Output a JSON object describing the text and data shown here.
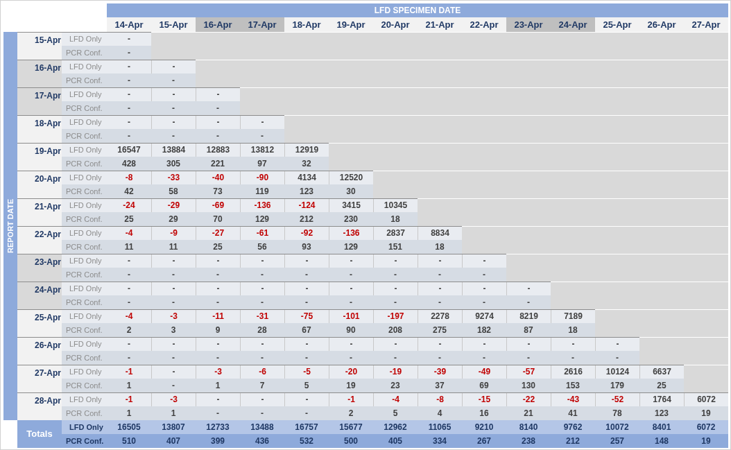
{
  "title": "LFD SPECIMEN DATE",
  "side_title": "REPORT DATE",
  "columns": [
    {
      "label": "14-Apr",
      "weekend": false
    },
    {
      "label": "15-Apr",
      "weekend": false
    },
    {
      "label": "16-Apr",
      "weekend": true
    },
    {
      "label": "17-Apr",
      "weekend": true
    },
    {
      "label": "18-Apr",
      "weekend": false
    },
    {
      "label": "19-Apr",
      "weekend": false
    },
    {
      "label": "20-Apr",
      "weekend": false
    },
    {
      "label": "21-Apr",
      "weekend": false
    },
    {
      "label": "22-Apr",
      "weekend": false
    },
    {
      "label": "23-Apr",
      "weekend": true
    },
    {
      "label": "24-Apr",
      "weekend": true
    },
    {
      "label": "25-Apr",
      "weekend": false
    },
    {
      "label": "26-Apr",
      "weekend": false
    },
    {
      "label": "27-Apr",
      "weekend": false
    }
  ],
  "rows": [
    {
      "date": "15-Apr",
      "weekend": false,
      "lfd_label": "LFD Only",
      "pcr_label": "PCR Conf.",
      "lfd": [
        {
          "value": "-",
          "negative": false
        }
      ],
      "pcr": [
        "-"
      ]
    },
    {
      "date": "16-Apr",
      "weekend": true,
      "lfd_label": "LFD Only",
      "pcr_label": "PCR Conf.",
      "lfd": [
        {
          "value": "-",
          "negative": false
        },
        {
          "value": "-",
          "negative": false
        }
      ],
      "pcr": [
        "-",
        "-"
      ]
    },
    {
      "date": "17-Apr",
      "weekend": true,
      "lfd_label": "LFD Only",
      "pcr_label": "PCR Conf.",
      "lfd": [
        {
          "value": "-",
          "negative": false
        },
        {
          "value": "-",
          "negative": false
        },
        {
          "value": "-",
          "negative": false
        }
      ],
      "pcr": [
        "-",
        "-",
        "-"
      ]
    },
    {
      "date": "18-Apr",
      "weekend": false,
      "lfd_label": "LFD Only",
      "pcr_label": "PCR Conf.",
      "lfd": [
        {
          "value": "-",
          "negative": false
        },
        {
          "value": "-",
          "negative": false
        },
        {
          "value": "-",
          "negative": false
        },
        {
          "value": "-",
          "negative": false
        }
      ],
      "pcr": [
        "-",
        "-",
        "-",
        "-"
      ]
    },
    {
      "date": "19-Apr",
      "weekend": false,
      "lfd_label": "LFD Only",
      "pcr_label": "PCR Conf.",
      "lfd": [
        {
          "value": "16547",
          "negative": false
        },
        {
          "value": "13884",
          "negative": false
        },
        {
          "value": "12883",
          "negative": false
        },
        {
          "value": "13812",
          "negative": false
        },
        {
          "value": "12919",
          "negative": false
        }
      ],
      "pcr": [
        "428",
        "305",
        "221",
        "97",
        "32"
      ]
    },
    {
      "date": "20-Apr",
      "weekend": false,
      "lfd_label": "LFD Only",
      "pcr_label": "PCR Conf.",
      "lfd": [
        {
          "value": "-8",
          "negative": true
        },
        {
          "value": "-33",
          "negative": true
        },
        {
          "value": "-40",
          "negative": true
        },
        {
          "value": "-90",
          "negative": true
        },
        {
          "value": "4134",
          "negative": false
        },
        {
          "value": "12520",
          "negative": false
        }
      ],
      "pcr": [
        "42",
        "58",
        "73",
        "119",
        "123",
        "30"
      ]
    },
    {
      "date": "21-Apr",
      "weekend": false,
      "lfd_label": "LFD Only",
      "pcr_label": "PCR Conf.",
      "lfd": [
        {
          "value": "-24",
          "negative": true
        },
        {
          "value": "-29",
          "negative": true
        },
        {
          "value": "-69",
          "negative": true
        },
        {
          "value": "-136",
          "negative": true
        },
        {
          "value": "-124",
          "negative": true
        },
        {
          "value": "3415",
          "negative": false
        },
        {
          "value": "10345",
          "negative": false
        }
      ],
      "pcr": [
        "25",
        "29",
        "70",
        "129",
        "212",
        "230",
        "18"
      ]
    },
    {
      "date": "22-Apr",
      "weekend": false,
      "lfd_label": "LFD Only",
      "pcr_label": "PCR Conf.",
      "lfd": [
        {
          "value": "-4",
          "negative": true
        },
        {
          "value": "-9",
          "negative": true
        },
        {
          "value": "-27",
          "negative": true
        },
        {
          "value": "-61",
          "negative": true
        },
        {
          "value": "-92",
          "negative": true
        },
        {
          "value": "-136",
          "negative": true
        },
        {
          "value": "2837",
          "negative": false
        },
        {
          "value": "8834",
          "negative": false
        }
      ],
      "pcr": [
        "11",
        "11",
        "25",
        "56",
        "93",
        "129",
        "151",
        "18"
      ]
    },
    {
      "date": "23-Apr",
      "weekend": true,
      "lfd_label": "LFD Only",
      "pcr_label": "PCR Conf.",
      "lfd": [
        {
          "value": "-",
          "negative": false
        },
        {
          "value": "-",
          "negative": false
        },
        {
          "value": "-",
          "negative": false
        },
        {
          "value": "-",
          "negative": false
        },
        {
          "value": "-",
          "negative": false
        },
        {
          "value": "-",
          "negative": false
        },
        {
          "value": "-",
          "negative": false
        },
        {
          "value": "-",
          "negative": false
        },
        {
          "value": "-",
          "negative": false
        }
      ],
      "pcr": [
        "-",
        "-",
        "-",
        "-",
        "-",
        "-",
        "-",
        "-",
        "-"
      ]
    },
    {
      "date": "24-Apr",
      "weekend": true,
      "lfd_label": "LFD Only",
      "pcr_label": "PCR Conf.",
      "lfd": [
        {
          "value": "-",
          "negative": false
        },
        {
          "value": "-",
          "negative": false
        },
        {
          "value": "-",
          "negative": false
        },
        {
          "value": "-",
          "negative": false
        },
        {
          "value": "-",
          "negative": false
        },
        {
          "value": "-",
          "negative": false
        },
        {
          "value": "-",
          "negative": false
        },
        {
          "value": "-",
          "negative": false
        },
        {
          "value": "-",
          "negative": false
        },
        {
          "value": "-",
          "negative": false
        }
      ],
      "pcr": [
        "-",
        "-",
        "-",
        "-",
        "-",
        "-",
        "-",
        "-",
        "-",
        "-"
      ]
    },
    {
      "date": "25-Apr",
      "weekend": false,
      "lfd_label": "LFD Only",
      "pcr_label": "PCR Conf.",
      "lfd": [
        {
          "value": "-4",
          "negative": true
        },
        {
          "value": "-3",
          "negative": true
        },
        {
          "value": "-11",
          "negative": true
        },
        {
          "value": "-31",
          "negative": true
        },
        {
          "value": "-75",
          "negative": true
        },
        {
          "value": "-101",
          "negative": true
        },
        {
          "value": "-197",
          "negative": true
        },
        {
          "value": "2278",
          "negative": false
        },
        {
          "value": "9274",
          "negative": false
        },
        {
          "value": "8219",
          "negative": false
        },
        {
          "value": "7189",
          "negative": false
        }
      ],
      "pcr": [
        "2",
        "3",
        "9",
        "28",
        "67",
        "90",
        "208",
        "275",
        "182",
        "87",
        "18"
      ]
    },
    {
      "date": "26-Apr",
      "weekend": false,
      "lfd_label": "LFD Only",
      "pcr_label": "PCR Conf.",
      "lfd": [
        {
          "value": "-",
          "negative": false
        },
        {
          "value": "-",
          "negative": false
        },
        {
          "value": "-",
          "negative": false
        },
        {
          "value": "-",
          "negative": false
        },
        {
          "value": "-",
          "negative": false
        },
        {
          "value": "-",
          "negative": false
        },
        {
          "value": "-",
          "negative": false
        },
        {
          "value": "-",
          "negative": false
        },
        {
          "value": "-",
          "negative": false
        },
        {
          "value": "-",
          "negative": false
        },
        {
          "value": "-",
          "negative": false
        },
        {
          "value": "-",
          "negative": false
        }
      ],
      "pcr": [
        "-",
        "-",
        "-",
        "-",
        "-",
        "-",
        "-",
        "-",
        "-",
        "-",
        "-",
        "-"
      ]
    },
    {
      "date": "27-Apr",
      "weekend": false,
      "lfd_label": "LFD Only",
      "pcr_label": "PCR Conf.",
      "lfd": [
        {
          "value": "-1",
          "negative": true
        },
        {
          "value": "-",
          "negative": false
        },
        {
          "value": "-3",
          "negative": true
        },
        {
          "value": "-6",
          "negative": true
        },
        {
          "value": "-5",
          "negative": true
        },
        {
          "value": "-20",
          "negative": true
        },
        {
          "value": "-19",
          "negative": true
        },
        {
          "value": "-39",
          "negative": true
        },
        {
          "value": "-49",
          "negative": true
        },
        {
          "value": "-57",
          "negative": true
        },
        {
          "value": "2616",
          "negative": false
        },
        {
          "value": "10124",
          "negative": false
        },
        {
          "value": "6637",
          "negative": false
        }
      ],
      "pcr": [
        "1",
        "-",
        "1",
        "7",
        "5",
        "19",
        "23",
        "37",
        "69",
        "130",
        "153",
        "179",
        "25"
      ]
    },
    {
      "date": "28-Apr",
      "weekend": false,
      "lfd_label": "LFD Only",
      "pcr_label": "PCR Conf.",
      "lfd": [
        {
          "value": "-1",
          "negative": true
        },
        {
          "value": "-3",
          "negative": true
        },
        {
          "value": "-",
          "negative": false
        },
        {
          "value": "-",
          "negative": false
        },
        {
          "value": "-",
          "negative": false
        },
        {
          "value": "-1",
          "negative": true
        },
        {
          "value": "-4",
          "negative": true
        },
        {
          "value": "-8",
          "negative": true
        },
        {
          "value": "-15",
          "negative": true
        },
        {
          "value": "-22",
          "negative": true
        },
        {
          "value": "-43",
          "negative": true
        },
        {
          "value": "-52",
          "negative": true
        },
        {
          "value": "1764",
          "negative": false
        },
        {
          "value": "6072",
          "negative": false
        }
      ],
      "pcr": [
        "1",
        "1",
        "-",
        "-",
        "-",
        "2",
        "5",
        "4",
        "16",
        "21",
        "41",
        "78",
        "123",
        "19"
      ]
    }
  ],
  "totals": {
    "label": "Totals",
    "lfd_label": "LFD Only",
    "pcr_label": "PCR Conf.",
    "lfd": [
      "16505",
      "13807",
      "12733",
      "13488",
      "16757",
      "15677",
      "12962",
      "11065",
      "9210",
      "8140",
      "9762",
      "10072",
      "8401",
      "6072"
    ],
    "pcr": [
      "510",
      "407",
      "399",
      "436",
      "532",
      "500",
      "405",
      "334",
      "267",
      "238",
      "212",
      "257",
      "148",
      "19"
    ]
  }
}
